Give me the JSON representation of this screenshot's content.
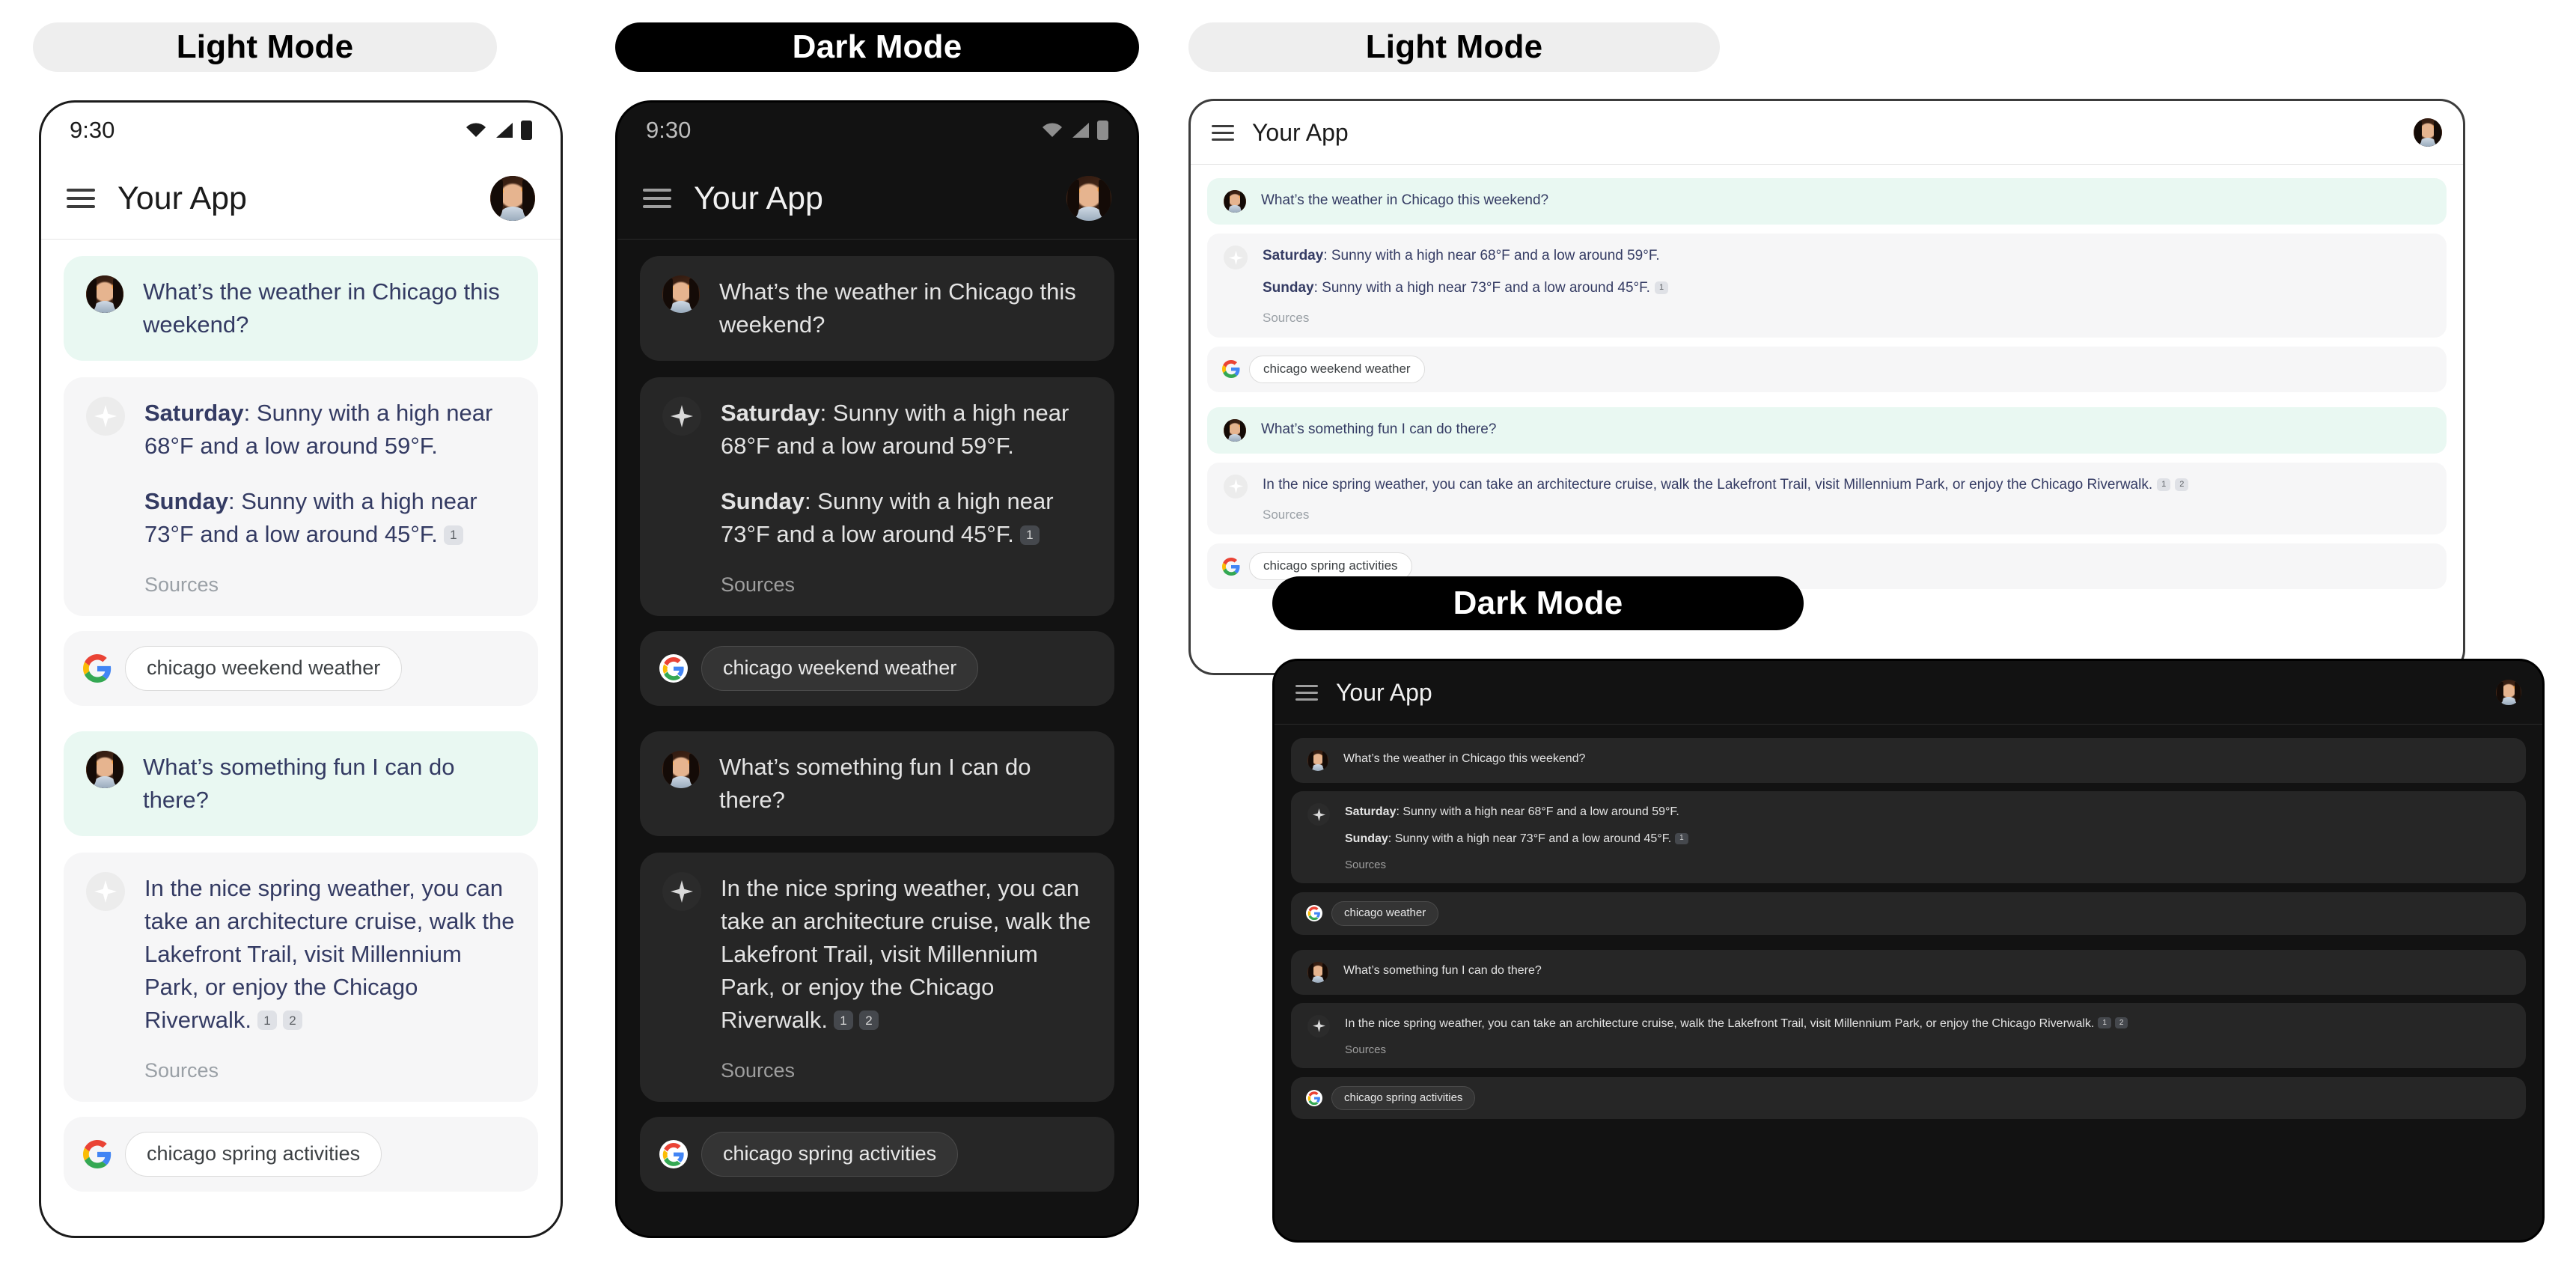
{
  "labels": {
    "light_mode": "Light Mode",
    "dark_mode": "Dark Mode"
  },
  "status": {
    "time": "9:30",
    "icons": [
      "wifi-icon",
      "signal-icon",
      "battery-icon"
    ]
  },
  "appbar": {
    "title": "Your App",
    "menu_icon": "hamburger-menu-icon",
    "avatar": "user-avatar"
  },
  "conversation": {
    "sources_label": "Sources",
    "turns": [
      {
        "user": "What’s the weather in Chicago this weekend?",
        "ai_lines": [
          {
            "label": "Saturday",
            "text": ": Sunny with a high near 68°F and a low around 59°F.",
            "cites": []
          },
          {
            "label": "Sunday",
            "text": ": Sunny with a high near 73°F and a low around 45°F.",
            "cites": [
              "1"
            ]
          }
        ],
        "ai_flat": "In the nice spring weather, you can take an architecture cruise, walk the Lakefront Trail, visit Millennium Park, or enjoy the Chicago Riverwalk.",
        "chip": "chicago weekend weather",
        "chip_short": "chicago weather"
      },
      {
        "user": "What’s something fun I can do there?",
        "ai_text": "In the nice spring weather, you can take an architecture cruise, walk the Lakefront Trail, visit Millennium Park, or enjoy the Chicago Riverwalk.",
        "cites": [
          "1",
          "2"
        ],
        "chip": "chicago spring activities"
      }
    ]
  },
  "icons": {
    "google": "google-g-icon",
    "sparkle": "ai-sparkle-icon"
  },
  "colors": {
    "user_bubble_light": "#e9f8f2",
    "ai_bubble_light": "#f6f6f7",
    "bubble_dark": "#262626",
    "text_light": "#343b63",
    "text_dark": "#e3e3e3",
    "surface_dark": "#121212",
    "citation_light": "#dfe1e6",
    "citation_dark": "#45484d",
    "accent_google_blue": "#4285F4",
    "accent_google_red": "#EA4335",
    "accent_google_yellow": "#FBBC05",
    "accent_google_green": "#34A853"
  }
}
